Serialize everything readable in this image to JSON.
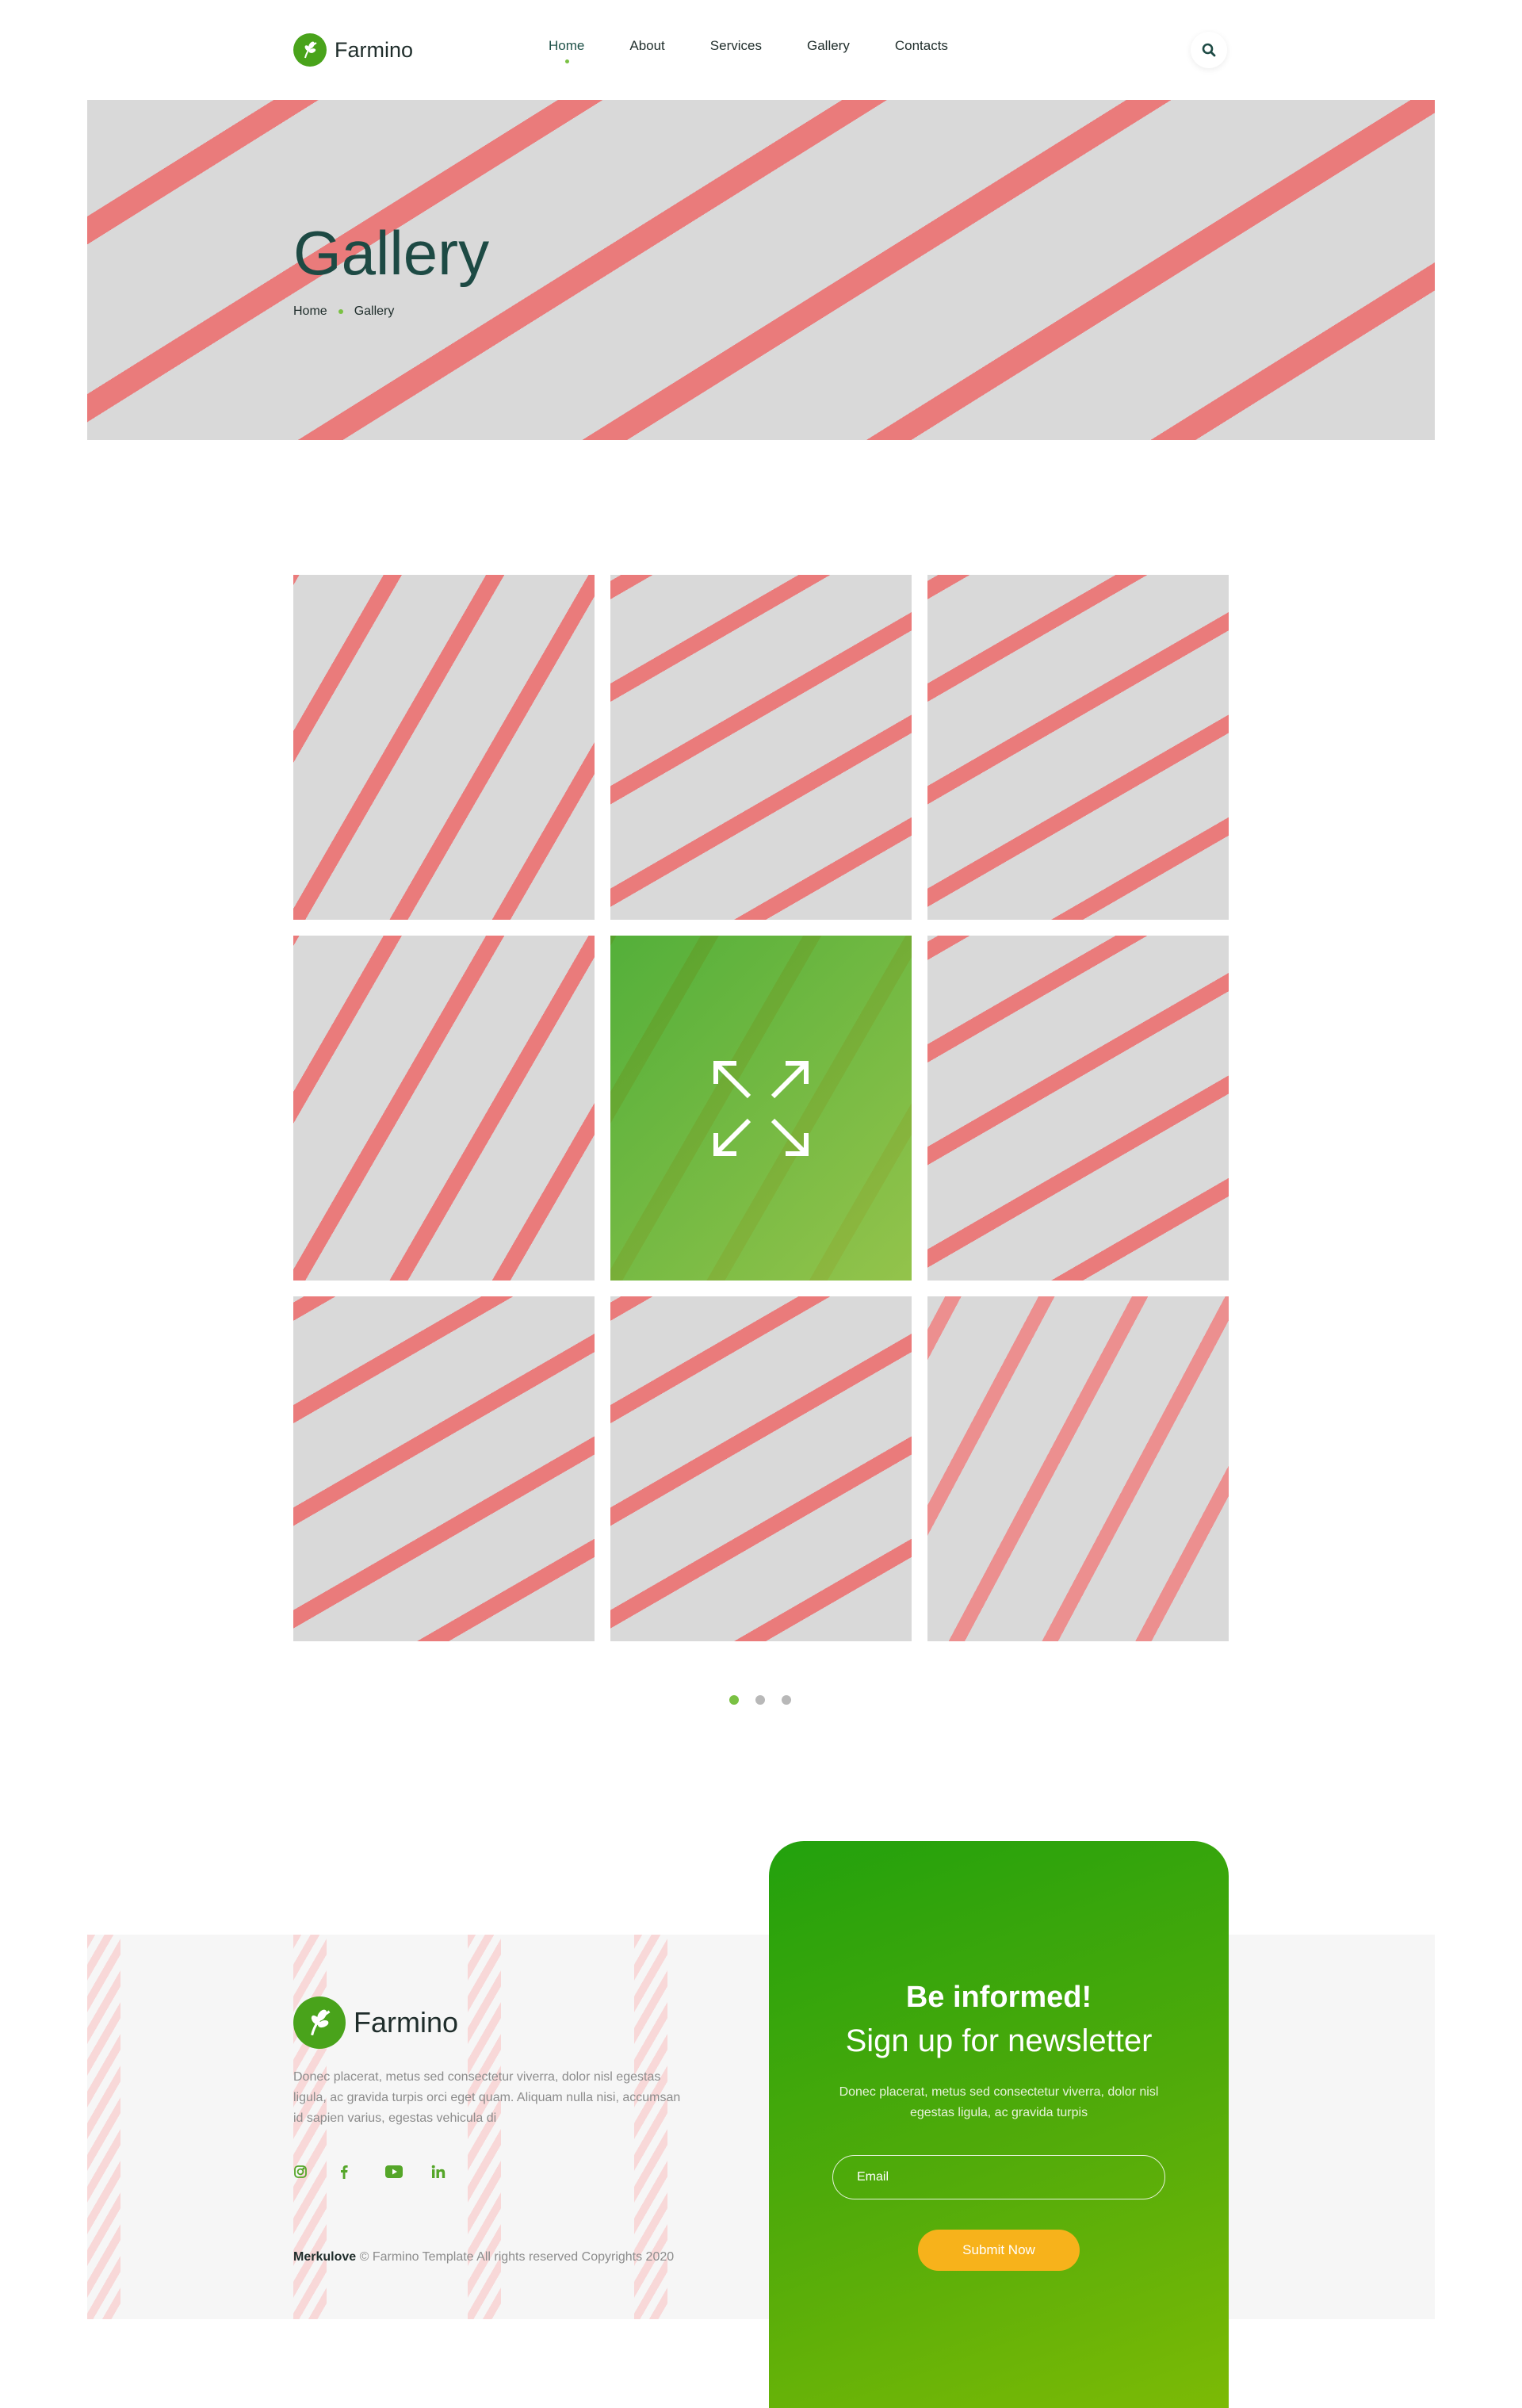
{
  "header": {
    "brand": "Farmino",
    "nav": [
      {
        "label": "Home",
        "active": true
      },
      {
        "label": "About",
        "active": false
      },
      {
        "label": "Services",
        "active": false
      },
      {
        "label": "Gallery",
        "active": false
      },
      {
        "label": "Contacts",
        "active": false
      }
    ],
    "search_icon": "search-icon"
  },
  "hero": {
    "title": "Gallery",
    "breadcrumb": [
      "Home",
      "Gallery"
    ]
  },
  "gallery": {
    "tile_count": 9,
    "hovered_tile_index": 4,
    "hover_icon": "expand-icon",
    "pages": 3,
    "active_page": 1
  },
  "footer": {
    "brand": "Farmino",
    "description": "Donec placerat, metus sed consectetur viverra, dolor nisl egestas ligula, ac gravida turpis orci eget quam. Aliquam nulla nisi, accumsan id sapien varius, egestas vehicula di",
    "socials": [
      "instagram-icon",
      "facebook-icon",
      "youtube-icon",
      "linkedin-icon"
    ],
    "copyright_brand": "Merkulove",
    "copyright_text": " © Farmino Template All rights reserved Copyrights 2020"
  },
  "newsletter": {
    "heading": "Be informed!",
    "subheading": "Sign up for newsletter",
    "text": "Donec placerat, metus sed consectetur viverra, dolor nisl egestas ligula, ac gravida turpis",
    "email_placeholder": "Email",
    "submit_label": "Submit Now"
  },
  "colors": {
    "brand_green": "#49a31b",
    "accent_green": "#7ac143",
    "title_dark": "#1d4a44",
    "button_yellow": "#f7b21b"
  }
}
